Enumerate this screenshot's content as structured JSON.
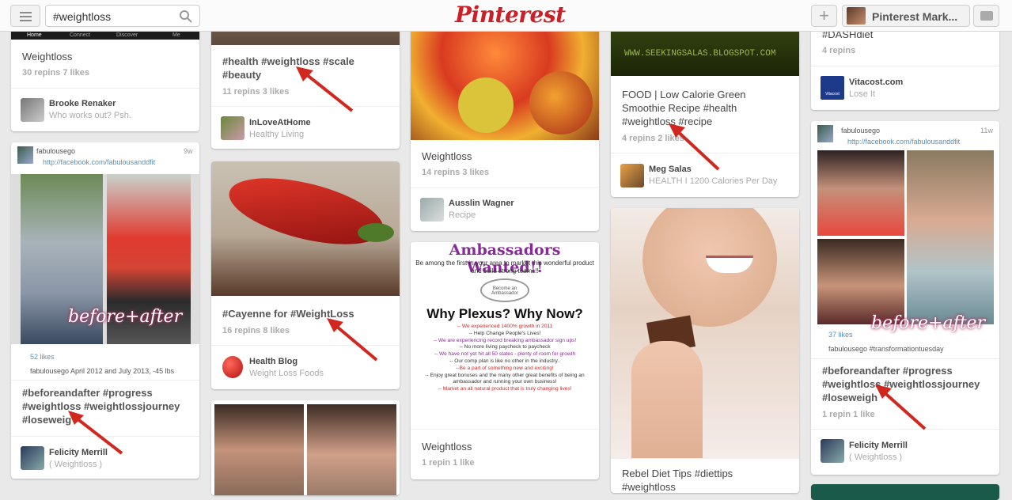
{
  "header": {
    "search_value": "#weightloss",
    "logo": "Pinterest",
    "profile_name": "Pinterest Mark...",
    "plus_label": "+"
  },
  "columns": {
    "col1": {
      "pin1": {
        "nav_tabs": [
          "Home",
          "Connect",
          "Discover",
          "Me"
        ],
        "desc": "Weightloss",
        "stats": "30 repins   7 likes",
        "user": "Brooke Renaker",
        "board": "Who works out? Psh."
      },
      "pin2": {
        "src_user": "fabulousego",
        "src_url": "http://facebook.com/fabulousanddfit",
        "src_time": "9w",
        "likes": "52 likes",
        "caption": "fabulousego April 2012 and July 2013, -45 lbs",
        "overlay": "before+after",
        "desc_lines": [
          "#beforeandafter #progress",
          "#weightloss #weightlossjourney",
          "#loseweig"
        ],
        "user": "Felicity Merrill",
        "board": "( Weightloss )"
      }
    },
    "col2": {
      "pin1": {
        "desc_lines": [
          "#health #weightloss #scale",
          "#beauty"
        ],
        "stats": "11 repins   3 likes",
        "user": "InLoveAtHome",
        "board": "Healthy Living"
      },
      "pin2": {
        "desc": "#Cayenne for #WeightLoss",
        "stats": "16 repins   8 likes",
        "user": "Health Blog",
        "board": "Weight Loss Foods"
      }
    },
    "col3": {
      "pin1": {
        "desc": "Weightloss",
        "stats": "14 repins   3 likes",
        "user": "Ausslin Wagner",
        "board": "Recipe"
      },
      "pin2": {
        "title": "Ambassadors Wanted!!",
        "intro": "Be among the first in your area to market this wonderful product and build strong teams!!",
        "badge": "Become an Ambassador",
        "headline": "Why Plexus? Why Now?",
        "bullets": [
          "-- We experienced 1400% growth in 2011",
          "-- Help Change People's Lives!",
          "-- We are experiencing record breaking ambassador sign ups!",
          "-- No more living paycheck to paycheck",
          "-- We have not yet hit all 50 states - plenty of room for growth",
          "-- Our comp plan is like no other in the industry..",
          "--Be a part of something new and exciting!",
          "-- Enjoy great bonuses and the many other great benefits of being an ambassador and running your own business!",
          "-- Market an all natural product that is truly changing lives!"
        ],
        "desc": "Weightloss",
        "stats": "1 repin   1 like"
      }
    },
    "col4": {
      "pin1": {
        "banner": "WWW.SEEKINGSALAS.BLOGSPOT.COM",
        "desc_lines": [
          "FOOD | Low Calorie Green",
          "Smoothie Recipe #health",
          "#weightloss #recipe"
        ],
        "stats": "4 repins   2 likes",
        "user": "Meg Salas",
        "board": "HEALTH I 1200 Calories Per Day"
      },
      "pin2": {
        "desc_lines": [
          "Rebel Diet Tips #diettips",
          "#weightloss"
        ]
      }
    },
    "col5": {
      "pin1": {
        "desc": "#DASHdiet",
        "stats": "4 repins",
        "user": "Vitacost.com",
        "board": "Lose It",
        "logo_text": "Vitacost"
      },
      "pin2": {
        "src_user": "fabulousego",
        "src_url": "http://facebook.com/fabulousanddfit",
        "src_time": "11w",
        "likes": "37 likes",
        "caption": "fabulousego #transformationtuesday",
        "overlay": "before+after",
        "desc_lines": [
          "#beforeandafter #progress",
          "#weightloss #weightlossjourney",
          "#loseweigh"
        ],
        "stats": "1 repin   1 like",
        "user": "Felicity Merrill",
        "board": "( Weightloss )"
      }
    }
  },
  "colors": {
    "brand": "#cb2027",
    "arrow": "#d0281e",
    "background": "#e9e9e9"
  }
}
